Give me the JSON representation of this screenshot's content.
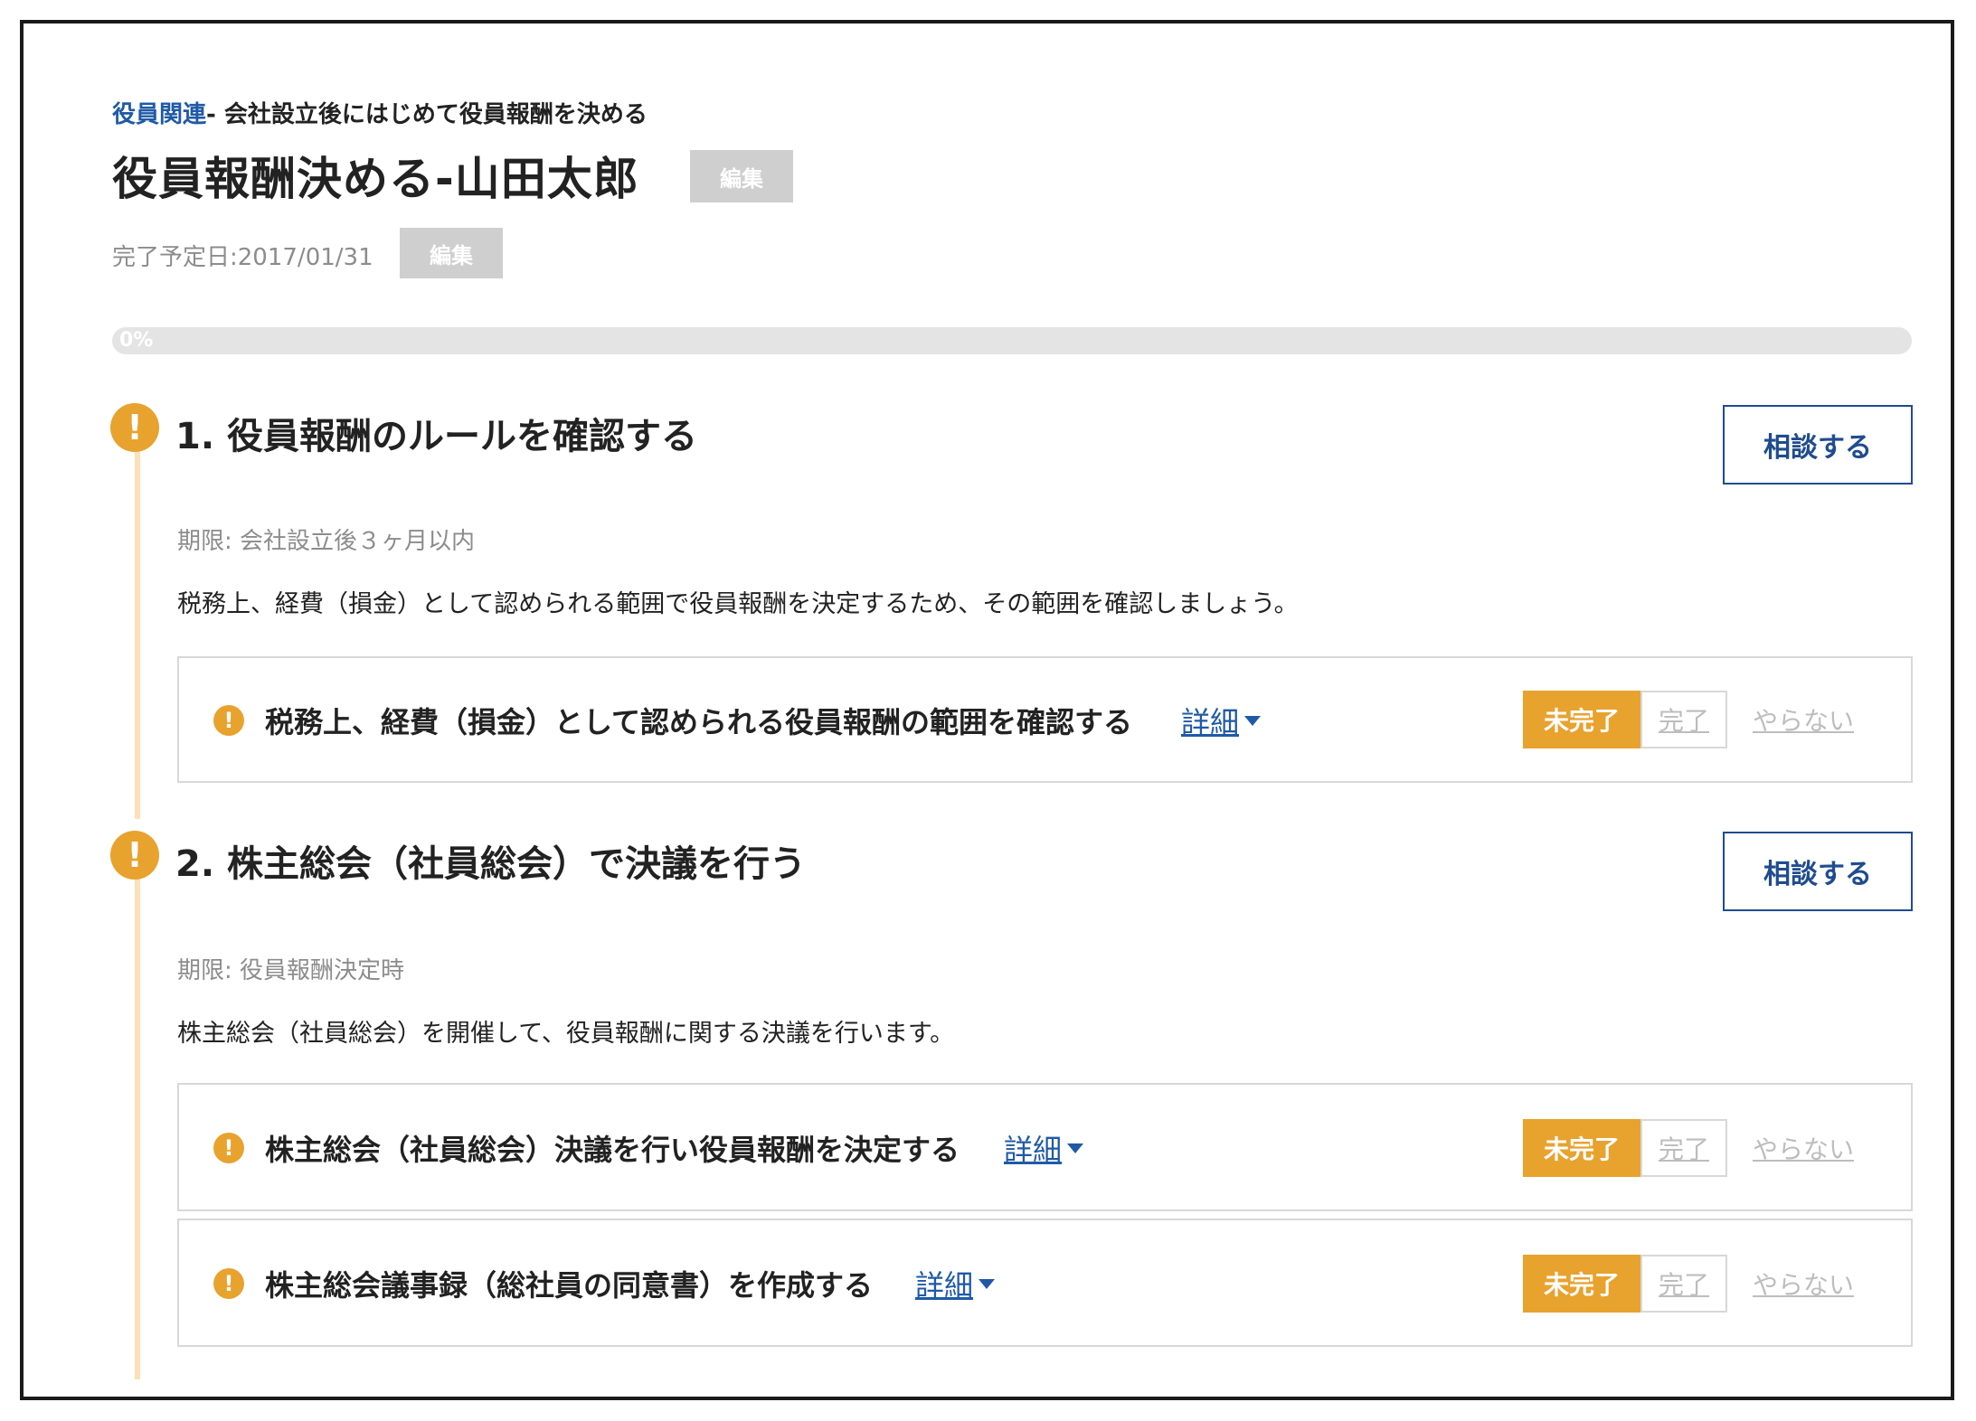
{
  "breadcrumb": {
    "category": "役員関連",
    "separator": "- ",
    "current": "会社設立後にはじめて役員報酬を決める"
  },
  "header": {
    "title": "役員報酬決める-山田太郎",
    "edit_label": "編集",
    "due_date": "完了予定日:2017/01/31",
    "due_edit_label": "編集"
  },
  "progress": {
    "label": "0%",
    "value": 0
  },
  "steps": [
    {
      "alert_glyph": "!",
      "title": "1. 役員報酬のルールを確認する",
      "consult_label": "相談する",
      "deadline": "期限: 会社設立後３ヶ月以内",
      "description": "税務上、経費（損金）として認められる範囲で役員報酬を決定するため、その範囲を確認しましょう。",
      "tasks": [
        {
          "alert_glyph": "!",
          "title": "税務上、経費（損金）として認められる役員報酬の範囲を確認する",
          "detail_label": "詳細",
          "status_incomplete": "未完了",
          "status_complete": "完了",
          "status_skip": "やらない",
          "selected_status": "未完了"
        }
      ]
    },
    {
      "alert_glyph": "!",
      "title": "2. 株主総会（社員総会）で決議を行う",
      "consult_label": "相談する",
      "deadline": "期限: 役員報酬決定時",
      "description": "株主総会（社員総会）を開催して、役員報酬に関する決議を行います。",
      "tasks": [
        {
          "alert_glyph": "!",
          "title": "株主総会（社員総会）決議を行い役員報酬を決定する",
          "detail_label": "詳細",
          "status_incomplete": "未完了",
          "status_complete": "完了",
          "status_skip": "やらない",
          "selected_status": "未完了"
        },
        {
          "alert_glyph": "!",
          "title": "株主総会議事録（総社員の同意書）を作成する",
          "detail_label": "詳細",
          "status_incomplete": "未完了",
          "status_complete": "完了",
          "status_skip": "やらない",
          "selected_status": "未完了"
        }
      ]
    }
  ],
  "colors": {
    "accent_orange": "#e8a22e",
    "link_blue": "#1f5aa6",
    "button_navy": "#1f4c8f",
    "timeline": "#fbe0b8"
  },
  "icons": {
    "step_alert": "exclamation-circle-icon",
    "task_alert": "exclamation-circle-icon",
    "detail_caret": "caret-down-icon"
  }
}
